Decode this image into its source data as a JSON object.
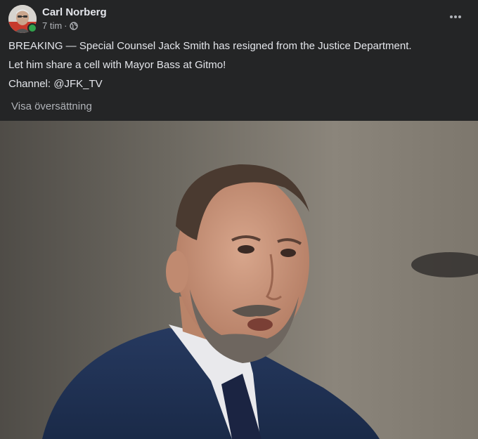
{
  "post": {
    "author_name": "Carl Norberg",
    "time_ago": "7 tim",
    "separator": "·",
    "privacy_icon": "globe-icon",
    "more_icon": "more-horizontal-icon",
    "lines": [
      "BREAKING — Special Counsel Jack Smith has resigned from the Justice Department.",
      "Let him share a cell with Mayor Bass at Gitmo!",
      "Channel: @JFK_TV"
    ],
    "translate_label": "Visa översättning",
    "online_status_color": "#31a24c"
  },
  "colors": {
    "background": "#242526",
    "primary_text": "#e4e6eb",
    "secondary_text": "#b0b3b8"
  }
}
